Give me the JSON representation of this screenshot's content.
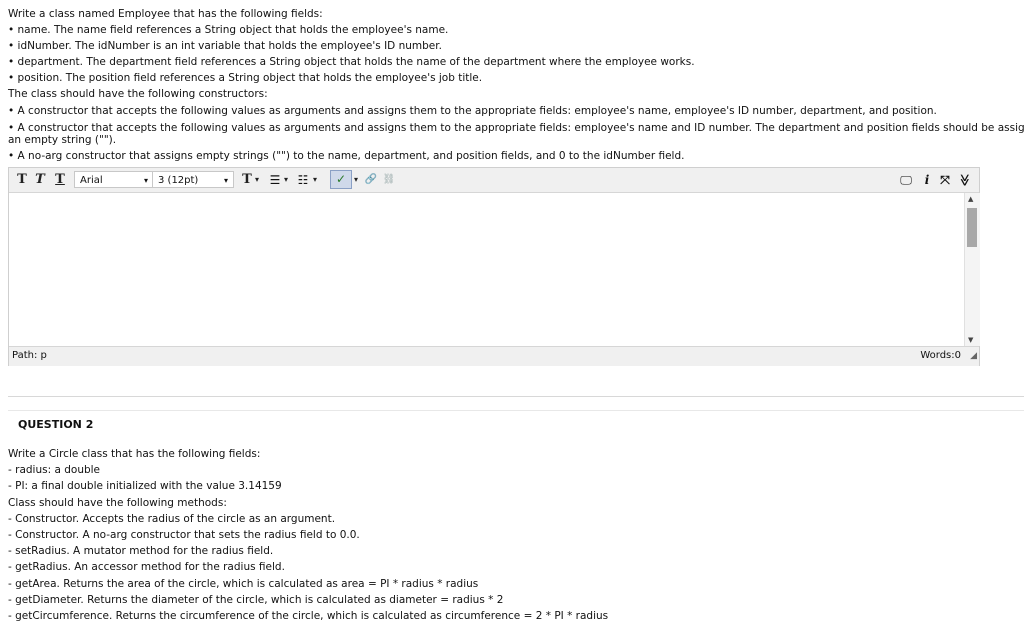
{
  "question1": {
    "lines": [
      "Write a class named Employee that has the following fields:",
      "• name. The name field references a String object that holds the employee's name.",
      "• idNumber. The idNumber is an int variable that holds the employee's ID number.",
      "• department. The department field references a String object that holds the name of the department where the employee works.",
      "• position. The position field references a String object that holds the employee's job title.",
      "The class should have the following constructors:",
      "• A constructor that accepts the following values as arguments and assigns them to the appropriate fields: employee's name, employee's ID number, department, and position.",
      "• A constructor that accepts the following values as arguments and assigns them to the appropriate fields: employee's name and ID number. The department and position fields should be assigned",
      "an empty string (\"\").",
      "• A no-arg constructor that assigns empty strings (\"\") to the name, department, and position fields, and 0 to the idNumber field."
    ]
  },
  "editor": {
    "toolbar": {
      "bold": "T",
      "italic": "T",
      "underline": "T",
      "font_family": "Arial",
      "font_size": "3 (12pt)",
      "text_color": "T",
      "bullets": "☰",
      "numbering": "☷",
      "spellcheck": "✓",
      "link": "🔗",
      "unlink": "⛓",
      "preview": "🖵",
      "info": "i",
      "fullscreen": "⤧",
      "expand": "≫",
      "dropdown_arrow": "▾"
    },
    "status": {
      "path": "Path: p",
      "words": "Words:0"
    }
  },
  "question2": {
    "title": "QUESTION 2",
    "lines": [
      "Write a Circle class that has the following fields:",
      "- radius: a double",
      "- PI: a final double initialized with the value 3.14159",
      "Class should have the following methods:",
      "- Constructor. Accepts the radius of the circle as an argument.",
      "- Constructor. A no-arg constructor that sets the radius field to 0.0.",
      "- setRadius. A mutator method for the radius field.",
      "- getRadius. An accessor method for the radius field.",
      "- getArea. Returns the area of the circle, which is calculated as area = PI * radius * radius",
      "- getDiameter. Returns the diameter of the circle, which is calculated as diameter = radius * 2",
      "- getCircumference. Returns the circumference of the circle, which is calculated as circumference = 2 * PI * radius"
    ]
  }
}
